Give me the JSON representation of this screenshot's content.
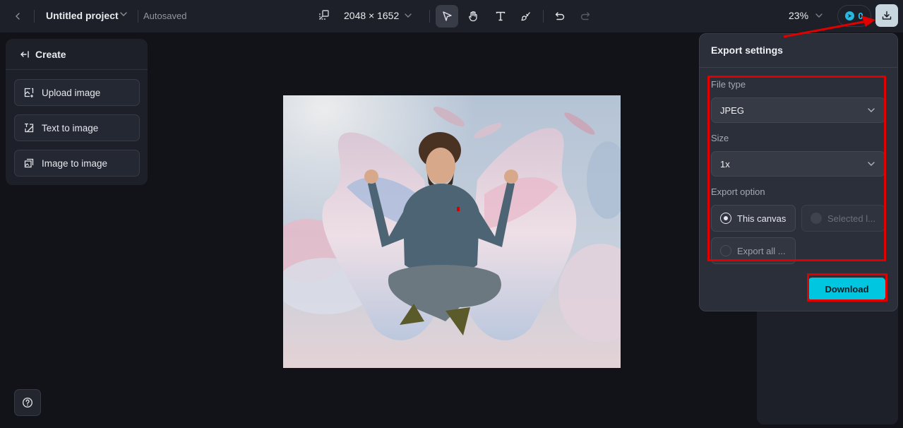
{
  "topbar": {
    "project_title": "Untitled project",
    "save_status": "Autosaved",
    "canvas_dimensions": "2048 × 1652",
    "zoom_level": "23%",
    "credits": "0",
    "tools": [
      {
        "name": "select",
        "icon": "cursor-arrow-icon",
        "active": true
      },
      {
        "name": "hand",
        "icon": "hand-icon",
        "active": false
      },
      {
        "name": "text",
        "icon": "text-icon",
        "active": false
      },
      {
        "name": "brush",
        "icon": "brush-icon",
        "active": false
      }
    ],
    "history": [
      {
        "name": "undo",
        "icon": "undo-icon",
        "enabled": true
      },
      {
        "name": "redo",
        "icon": "redo-icon",
        "enabled": false
      }
    ]
  },
  "create_panel": {
    "title": "Create",
    "items": [
      {
        "label": "Upload image",
        "icon": "upload-image-icon"
      },
      {
        "label": "Text to image",
        "icon": "text-to-image-icon"
      },
      {
        "label": "Image to image",
        "icon": "image-to-image-icon"
      }
    ]
  },
  "canvas": {
    "image_description": "Man with curly hair and beard jumping cross-legged in denim shirt and jeans, making OK hand gestures, in front of large pastel pink and blue feathered wings with floating feathers"
  },
  "export_settings": {
    "title": "Export settings",
    "file_type": {
      "label": "File type",
      "value": "JPEG"
    },
    "size": {
      "label": "Size",
      "value": "1x"
    },
    "export_option": {
      "label": "Export option",
      "options": [
        {
          "label": "This canvas",
          "selected": true,
          "disabled": false
        },
        {
          "label": "Selected l...",
          "selected": false,
          "disabled": true
        },
        {
          "label": "Export all ...",
          "selected": false,
          "disabled": false
        }
      ]
    },
    "download_label": "Download"
  },
  "colors": {
    "accent": "#00c6e0",
    "annotation": "#e00000",
    "background": "#121318",
    "panel": "#1d2028"
  }
}
